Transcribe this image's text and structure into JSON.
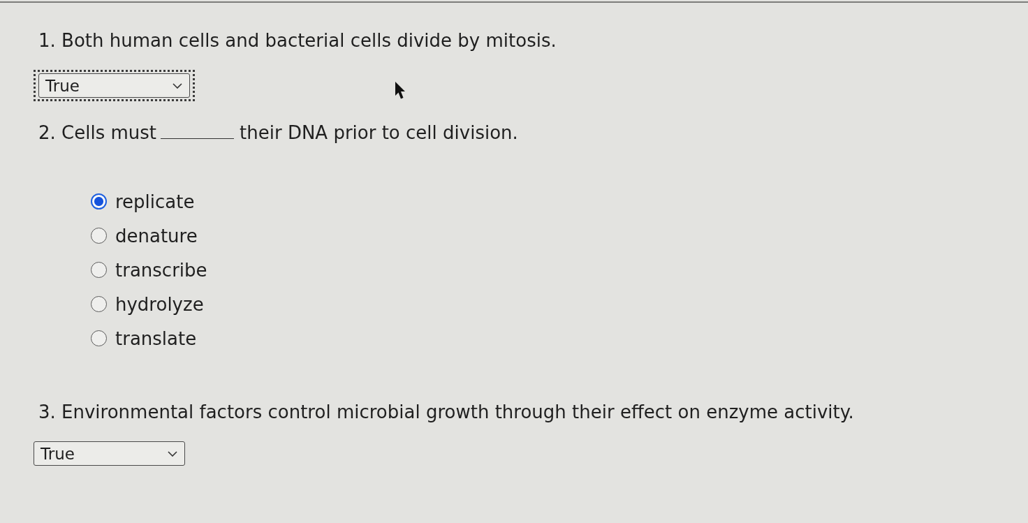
{
  "questions": [
    {
      "kind": "true_false",
      "text": "1. Both human cells and bacterial cells divide by mitosis.",
      "answer": "True",
      "focused": true
    },
    {
      "kind": "fill_in_blank",
      "text_before": "2. Cells must",
      "text_after": "their DNA prior to cell division.",
      "options": [
        {
          "label": "replicate",
          "selected": true
        },
        {
          "label": "denature",
          "selected": false
        },
        {
          "label": "transcribe",
          "selected": false
        },
        {
          "label": "hydrolyze",
          "selected": false
        },
        {
          "label": "translate",
          "selected": false
        }
      ]
    },
    {
      "kind": "true_false",
      "text": "3. Environmental factors control microbial growth through their effect on enzyme activity.",
      "answer": "True",
      "focused": false
    }
  ]
}
